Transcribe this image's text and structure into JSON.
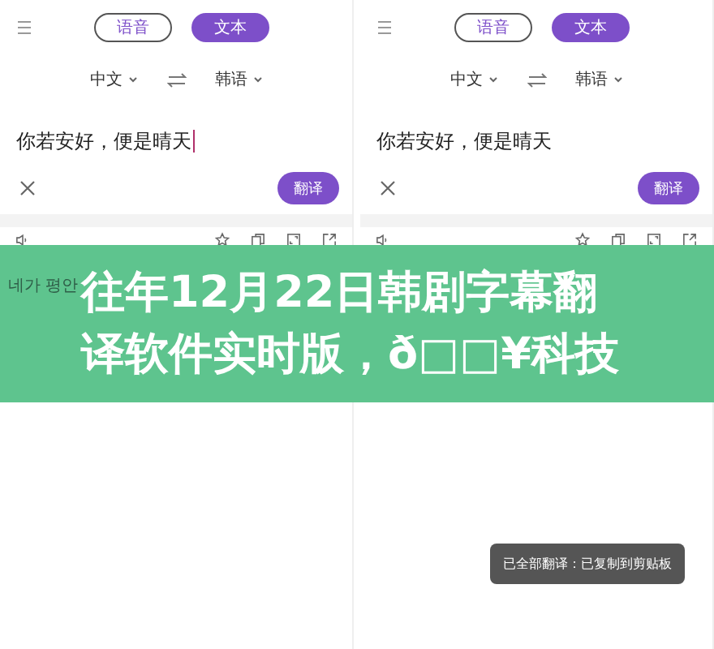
{
  "panels": [
    {
      "tabs": [
        {
          "label": "语音",
          "selected": false
        },
        {
          "label": "文本",
          "selected": true
        }
      ],
      "source_language": "中文",
      "target_language": "韩语",
      "input": {
        "value": "你若安好，便是晴天",
        "cursor": true
      },
      "translate_button": "翻译",
      "result": "네가 평안"
    },
    {
      "tabs": [
        {
          "label": "语音",
          "selected": false
        },
        {
          "label": "文本",
          "selected": true
        }
      ],
      "source_language": "中文",
      "target_language": "韩语",
      "input": {
        "value": "你若安好，便是晴天",
        "cursor": false
      },
      "translate_button": "翻译",
      "toast": "已全部翻译：已复制到剪贴板"
    }
  ],
  "banner": {
    "title": "往年12月22日韩剧字幕翻译软件实时版，ð□□¥科技"
  }
}
